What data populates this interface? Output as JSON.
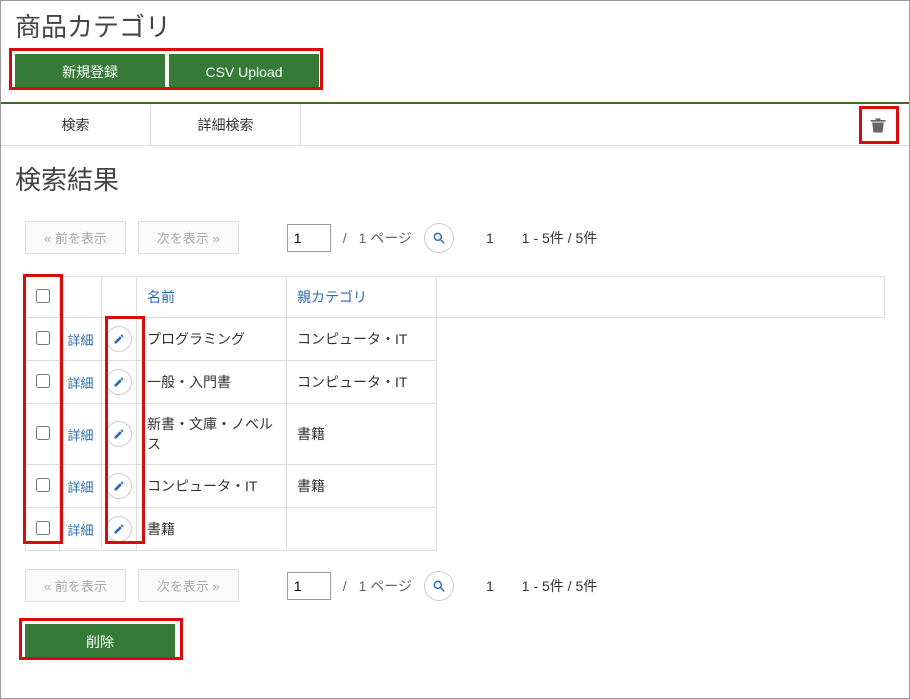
{
  "page_title": "商品カテゴリ",
  "top_buttons": {
    "register": "新規登録",
    "csv_upload": "CSV Upload"
  },
  "tabs": {
    "search": "検索",
    "advanced_search": "詳細検索"
  },
  "section_title": "検索結果",
  "pager": {
    "prev": "«  前を表示",
    "next": "次を表示  »",
    "page_value": "1",
    "page_total_prefix": "/",
    "page_total": "1 ページ",
    "current_page_num": "1",
    "range": "1 - 5件 / 5件"
  },
  "table": {
    "headers": {
      "name": "名前",
      "parent": "親カテゴリ"
    },
    "detail_label": "詳細",
    "rows": [
      {
        "name": "プログラミング",
        "parent": "コンピュータ・IT"
      },
      {
        "name": "一般・入門書",
        "parent": "コンピュータ・IT"
      },
      {
        "name": "新書・文庫・ノベルス",
        "parent": "書籍"
      },
      {
        "name": "コンピュータ・IT",
        "parent": "書籍"
      },
      {
        "name": "書籍",
        "parent": ""
      }
    ]
  },
  "delete_button": "削除"
}
